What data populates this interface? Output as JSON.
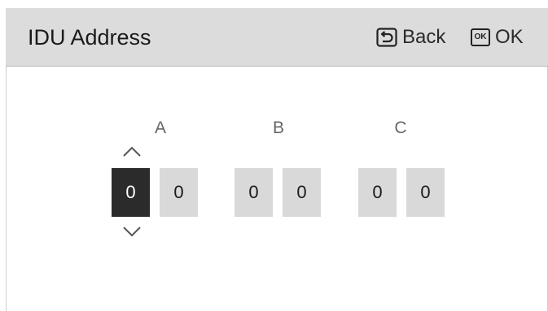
{
  "header": {
    "title": "IDU Address",
    "back_label": "Back",
    "ok_label": "OK",
    "ok_icon_text": "OK"
  },
  "groups": [
    {
      "label": "A",
      "digits": [
        "0",
        "0"
      ]
    },
    {
      "label": "B",
      "digits": [
        "0",
        "0"
      ]
    },
    {
      "label": "C",
      "digits": [
        "0",
        "0"
      ]
    }
  ],
  "selection": {
    "group": "A",
    "digit_index": 0
  },
  "icons": {
    "back": "back-arrow-icon",
    "ok": "ok-key-icon",
    "up": "chevron-up-icon",
    "down": "chevron-down-icon"
  },
  "colors": {
    "header_bg": "#dcdcdc",
    "digit_bg": "#d9d9d9",
    "digit_active_bg": "#2b2b2b",
    "digit_active_text": "#ffffff",
    "label_text": "#666666"
  }
}
